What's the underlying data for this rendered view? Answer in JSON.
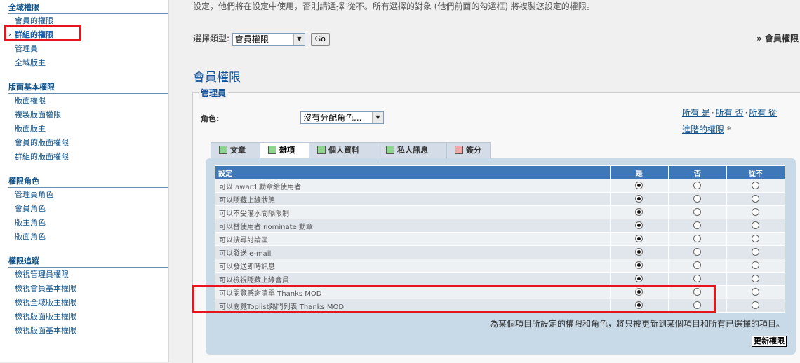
{
  "sidebar": {
    "sections": [
      {
        "title": "全域權限",
        "items": [
          {
            "label": "會員的權限",
            "active": false
          },
          {
            "label": "群組的權限",
            "active": true
          },
          {
            "label": "管理員",
            "active": false
          },
          {
            "label": "全域版主",
            "active": false
          }
        ]
      },
      {
        "title": "版面基本權限",
        "items": [
          {
            "label": "版面權限"
          },
          {
            "label": "複製版面權限"
          },
          {
            "label": "版面版主"
          },
          {
            "label": "會員的版面權限"
          },
          {
            "label": "群組的版面權限"
          }
        ]
      },
      {
        "title": "權限角色",
        "items": [
          {
            "label": "管理員角色"
          },
          {
            "label": "會員角色"
          },
          {
            "label": "版主角色"
          },
          {
            "label": "版面角色"
          }
        ]
      },
      {
        "title": "權限追蹤",
        "items": [
          {
            "label": "檢視管理員權限"
          },
          {
            "label": "檢視會員基本權限"
          },
          {
            "label": "檢視全域版主權限"
          },
          {
            "label": "檢視版面版主權限"
          },
          {
            "label": "檢視版面基本權限"
          }
        ]
      }
    ]
  },
  "main": {
    "intro": "設定，他們將在設定中使用，否則請選擇 從不。所有選擇的對象 (他們前面的勾選框) 將複製您設定的權限。",
    "select_type_label": "選擇類型:",
    "select_type_value": "會員權限",
    "go_label": "Go",
    "breadcrumb": "» 會員權限",
    "page_title": "會員權限",
    "legend": "管理員",
    "role_label": "角色:",
    "role_value": "沒有分配角色...",
    "quick_links": {
      "all_yes": "所有 是",
      "all_no": "所有 否",
      "all_never": "所有 從",
      "advanced": "進階的權限",
      "star": "*"
    },
    "tabs": [
      {
        "label": "文章",
        "color": "#8ed38e"
      },
      {
        "label": "雜項",
        "color": "#8ed38e"
      },
      {
        "label": "個人資料",
        "color": "#8ed38e"
      },
      {
        "label": "私人訊息",
        "color": "#8ed38e"
      },
      {
        "label": "簽分",
        "color": "#f2a7a7"
      }
    ],
    "table": {
      "headers": {
        "setting": "設定",
        "yes": "是",
        "no": "否",
        "never": "從不"
      },
      "rows": [
        {
          "label": "可以 award 勳章給使用者",
          "value": "yes"
        },
        {
          "label": "可以隱藏上線狀態",
          "value": "yes"
        },
        {
          "label": "可以不受灌水間隔限制",
          "value": "yes"
        },
        {
          "label": "可以替使用者 nominate 勳章",
          "value": "yes"
        },
        {
          "label": "可以搜尋討論區",
          "value": "yes"
        },
        {
          "label": "可以發送 e-mail",
          "value": "yes"
        },
        {
          "label": "可以發送即時訊息",
          "value": "yes"
        },
        {
          "label": "可以檢視隱藏上線會員",
          "value": "yes"
        },
        {
          "label": "可以閱覽感謝清單 Thanks MOD",
          "value": "yes"
        },
        {
          "label": "可以閱覽Toplist熱門列表 Thanks MOD",
          "value": "yes"
        }
      ]
    },
    "note": "為某個項目所設定的權限和角色，將只被更新到某個項目和所有已選擇的項目。",
    "update_label": "更新權限"
  },
  "colors": {
    "accent": "#105289",
    "header_blue": "#3e78b8",
    "highlight": "#e8141c"
  }
}
